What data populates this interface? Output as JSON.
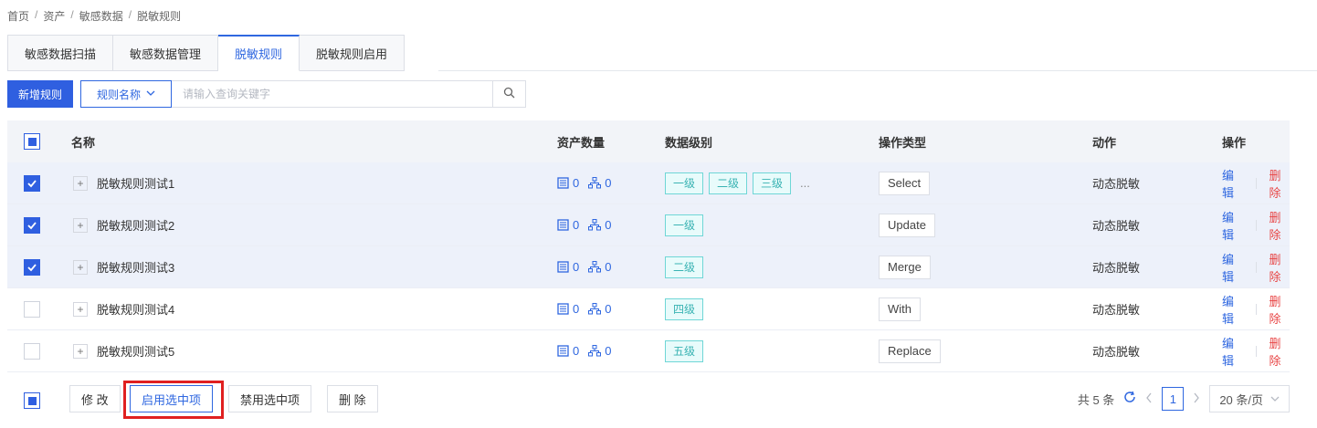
{
  "breadcrumb": [
    "首页",
    "资产",
    "敏感数据",
    "脱敏规则"
  ],
  "breadcrumb_sep": "/",
  "tabs": [
    {
      "label": "敏感数据扫描",
      "active": false
    },
    {
      "label": "敏感数据管理",
      "active": false
    },
    {
      "label": "脱敏规则",
      "active": true
    },
    {
      "label": "脱敏规则启用",
      "active": false
    }
  ],
  "toolbar": {
    "add_label": "新增规则",
    "filter_label": "规则名称",
    "search_placeholder": "请输入查询关键字"
  },
  "table": {
    "headers": {
      "name": "名称",
      "assets": "资产数量",
      "level": "数据级别",
      "op_type": "操作类型",
      "action": "动作",
      "ops": "操作"
    },
    "rows": [
      {
        "checked": true,
        "name": "脱敏规则测试1",
        "asset_a": "0",
        "asset_b": "0",
        "levels": [
          "一级",
          "二级",
          "三级"
        ],
        "more": "...",
        "op_type": "Select",
        "action": "动态脱敏",
        "edit": "编辑",
        "delete": "删除"
      },
      {
        "checked": true,
        "name": "脱敏规则测试2",
        "asset_a": "0",
        "asset_b": "0",
        "levels": [
          "一级"
        ],
        "more": "",
        "op_type": "Update",
        "action": "动态脱敏",
        "edit": "编辑",
        "delete": "删除"
      },
      {
        "checked": true,
        "name": "脱敏规则测试3",
        "asset_a": "0",
        "asset_b": "0",
        "levels": [
          "二级"
        ],
        "more": "",
        "op_type": "Merge",
        "action": "动态脱敏",
        "edit": "编辑",
        "delete": "删除"
      },
      {
        "checked": false,
        "name": "脱敏规则测试4",
        "asset_a": "0",
        "asset_b": "0",
        "levels": [
          "四级"
        ],
        "more": "",
        "op_type": "With",
        "action": "动态脱敏",
        "edit": "编辑",
        "delete": "删除"
      },
      {
        "checked": false,
        "name": "脱敏规则测试5",
        "asset_a": "0",
        "asset_b": "0",
        "levels": [
          "五级"
        ],
        "more": "",
        "op_type": "Replace",
        "action": "动态脱敏",
        "edit": "编辑",
        "delete": "删除"
      }
    ]
  },
  "footer": {
    "modify_label": "修 改",
    "enable_label": "启用选中项",
    "disable_label": "禁用选中项",
    "delete_label": "删 除",
    "total_text": "共 5 条",
    "current_page": "1",
    "page_size": "20 条/页"
  },
  "colors": {
    "primary": "#2f5fe0",
    "danger": "#e84545",
    "highlight": "#e02020"
  }
}
